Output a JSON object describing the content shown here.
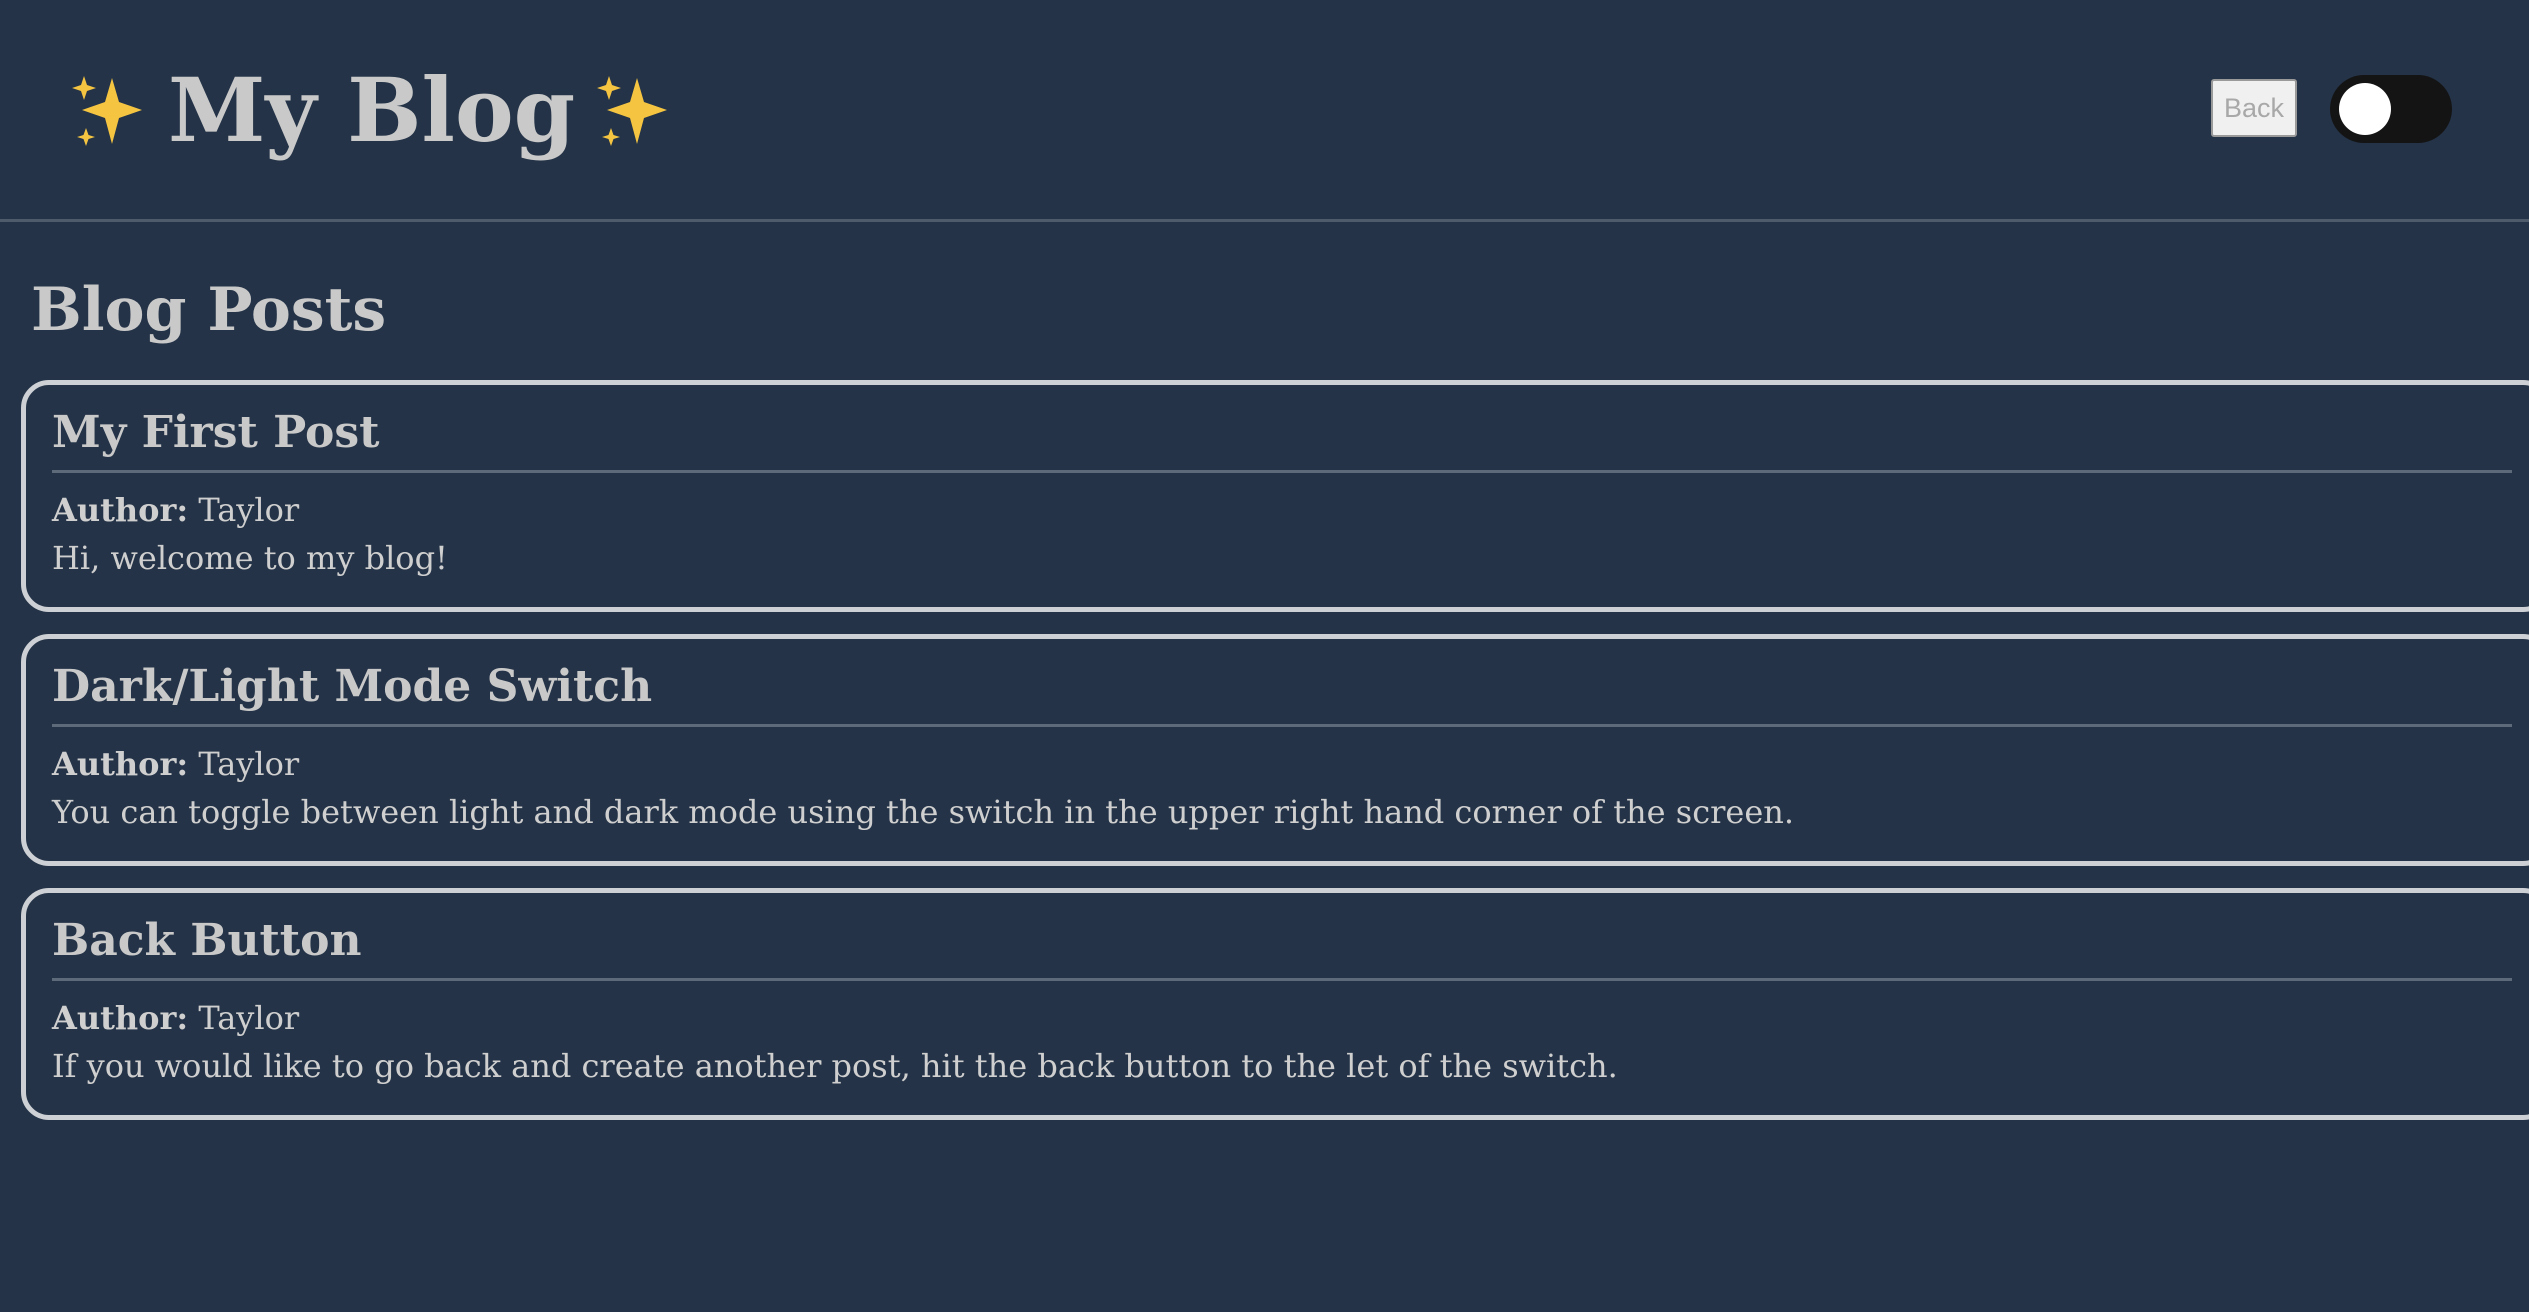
{
  "header": {
    "title": "My Blog",
    "title_icon": "sparkles-icon",
    "back_label": "Back",
    "theme_toggle": {
      "state": "dark",
      "icon": "toggle-switch"
    }
  },
  "main": {
    "heading": "Blog Posts",
    "posts": [
      {
        "title": "My First Post",
        "author_label": "Author:",
        "author": "Taylor",
        "body": "Hi, welcome to my blog!"
      },
      {
        "title": "Dark/Light Mode Switch",
        "author_label": "Author:",
        "author": "Taylor",
        "body": "You can toggle between light and dark mode using the switch in the upper right hand corner of the screen."
      },
      {
        "title": "Back Button",
        "author_label": "Author:",
        "author": "Taylor",
        "body": "If you would like to go back and create another post, hit the back button to the let of the switch."
      }
    ]
  },
  "colors": {
    "background": "#243347",
    "card_border": "#cdd0d4",
    "text": "#cfcfcf",
    "sparkle": "#f5c542"
  }
}
